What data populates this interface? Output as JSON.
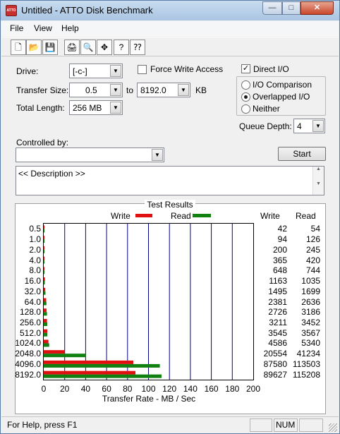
{
  "window": {
    "title": "Untitled - ATTO Disk Benchmark",
    "app_icon_text": "ATTO"
  },
  "title_buttons": {
    "minimize": "—",
    "maximize": "□",
    "close": "✕"
  },
  "menu": [
    "File",
    "View",
    "Help"
  ],
  "toolbar": [
    {
      "name": "new-icon",
      "glyph": "🗋"
    },
    {
      "name": "open-icon",
      "glyph": "📂"
    },
    {
      "name": "save-icon",
      "glyph": "💾"
    },
    {
      "name": "print-icon",
      "glyph": "🖨"
    },
    {
      "name": "print-preview-icon",
      "glyph": "🔍"
    },
    {
      "name": "move-icon",
      "glyph": "✥"
    },
    {
      "name": "about-icon",
      "glyph": "?"
    },
    {
      "name": "context-help-icon",
      "glyph": "⁇"
    }
  ],
  "settings": {
    "drive_label": "Drive:",
    "drive_value": "[-c-]",
    "force_write_label": "Force Write Access",
    "force_write_checked": false,
    "direct_io_label": "Direct I/O",
    "direct_io_checked": true,
    "transfer_size_label": "Transfer Size:",
    "transfer_from": "0.5",
    "to_label": "to",
    "transfer_to": "8192.0",
    "kb_label": "KB",
    "total_length_label": "Total Length:",
    "total_length_value": "256 MB",
    "io_modes": [
      {
        "label": "I/O Comparison",
        "selected": false
      },
      {
        "label": "Overlapped I/O",
        "selected": true
      },
      {
        "label": "Neither",
        "selected": false
      }
    ],
    "queue_depth_label": "Queue Depth:",
    "queue_depth_value": "4",
    "controlled_by_label": "Controlled by:",
    "controlled_by_value": "",
    "start_button": "Start",
    "description": "<< Description >>"
  },
  "results": {
    "title": "Test Results",
    "legend_write": "Write",
    "legend_read": "Read",
    "col_write": "Write",
    "col_read": "Read"
  },
  "chart_data": {
    "type": "bar",
    "orientation": "horizontal",
    "xlabel": "Transfer Rate - MB / Sec",
    "xlim": [
      0,
      200
    ],
    "xticks": [
      0,
      20,
      40,
      60,
      80,
      100,
      120,
      140,
      160,
      180,
      200
    ],
    "categories": [
      "0.5",
      "1.0",
      "2.0",
      "4.0",
      "8.0",
      "16.0",
      "32.0",
      "64.0",
      "128.0",
      "256.0",
      "512.0",
      "1024.0",
      "2048.0",
      "4096.0",
      "8192.0"
    ],
    "series": [
      {
        "name": "Write",
        "color": "#e01010",
        "values": [
          42,
          94,
          200,
          365,
          648,
          1163,
          1495,
          2381,
          2726,
          3211,
          3545,
          4586,
          20554,
          87580,
          89627
        ]
      },
      {
        "name": "Read",
        "color": "#108010",
        "values": [
          54,
          126,
          245,
          420,
          744,
          1035,
          1699,
          2636,
          3186,
          3452,
          3567,
          5340,
          41234,
          113503,
          115208
        ]
      }
    ],
    "grid_color": "#00008b"
  },
  "status": {
    "help_text": "For Help, press F1",
    "num": "NUM"
  }
}
